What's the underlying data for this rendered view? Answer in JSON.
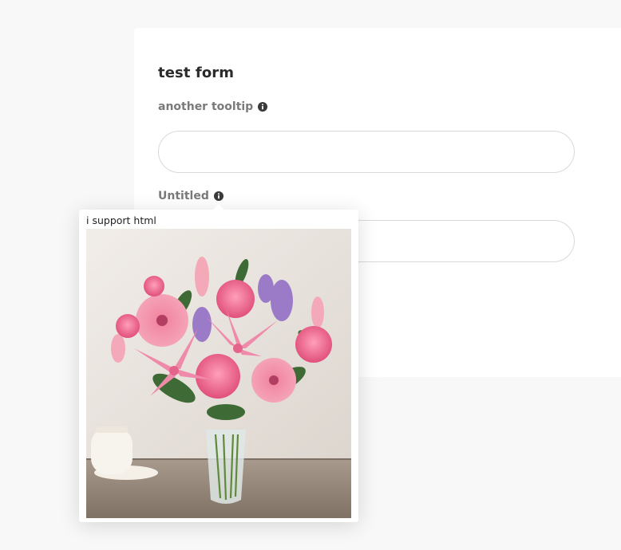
{
  "form": {
    "title": "test form",
    "fields": [
      {
        "label": "another tooltip",
        "value": "",
        "icon": "info-icon"
      },
      {
        "label": "Untitled",
        "value": "",
        "icon": "info-icon"
      }
    ]
  },
  "tooltip": {
    "text": "i support html",
    "image_subject": "flower-bouquet-image"
  },
  "colors": {
    "page_background": "#f8f8f8",
    "card_background": "#ffffff",
    "label_text": "#7a7a7a",
    "title_text": "#2b2b2b",
    "input_border": "#d9d9d9"
  }
}
